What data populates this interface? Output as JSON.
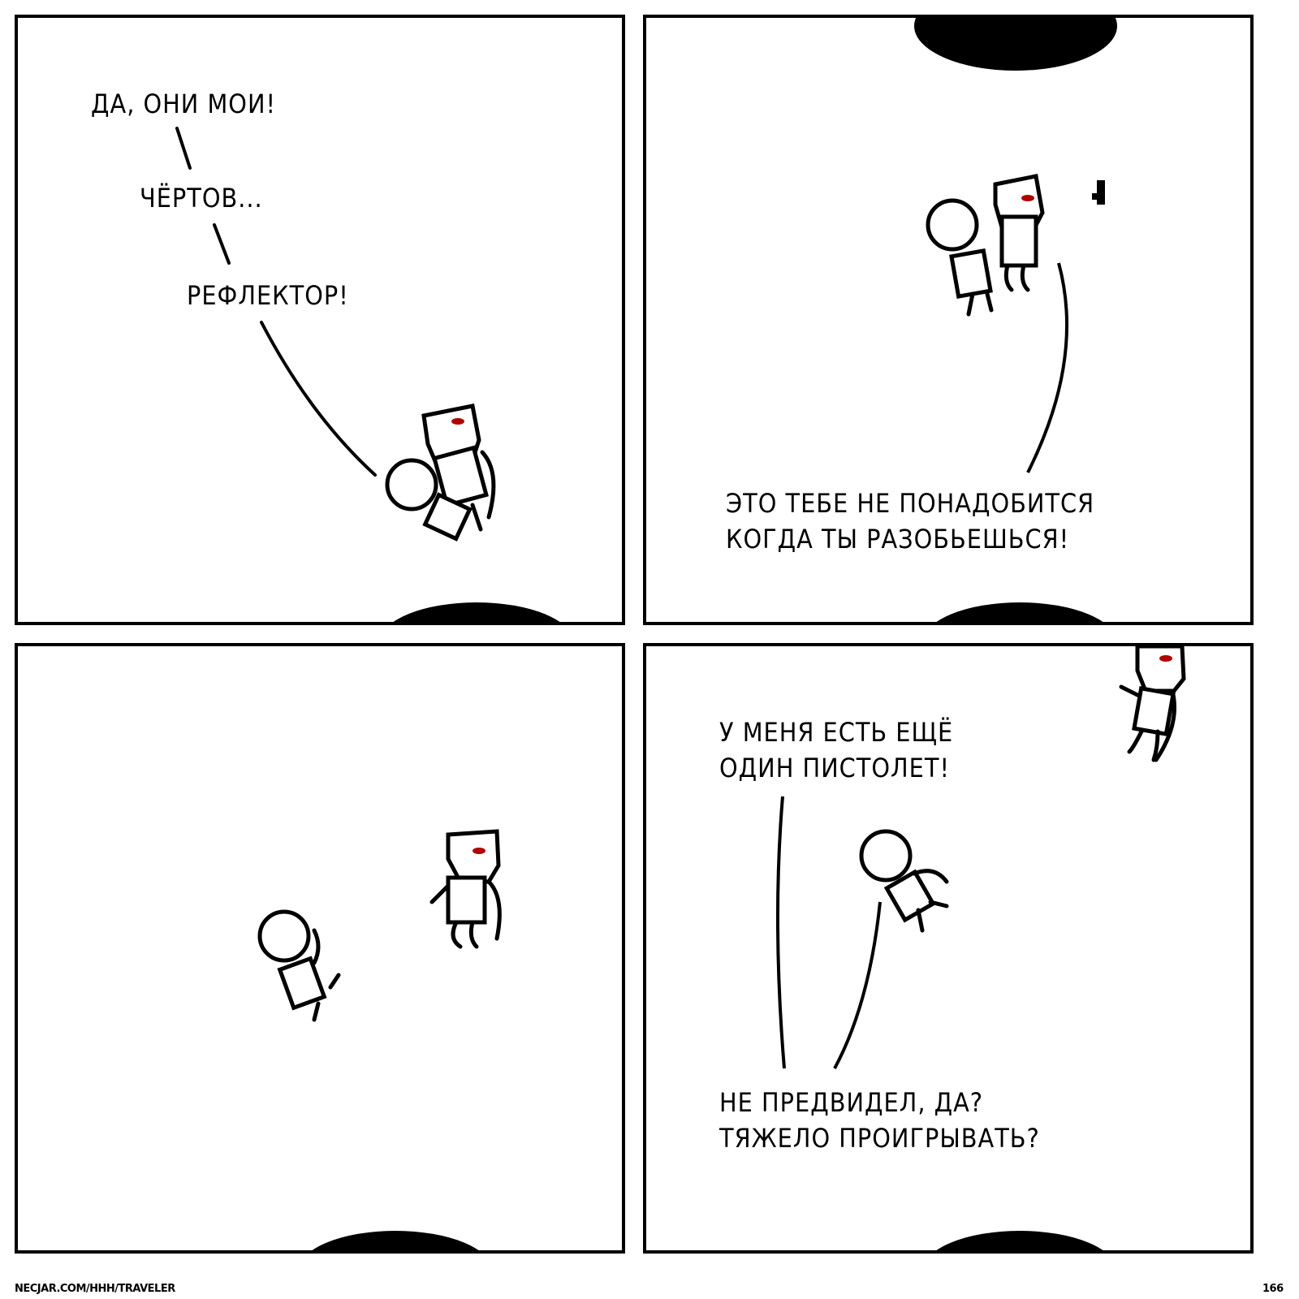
{
  "panels": [
    {
      "lines": [
        "Да, они мои!",
        "Чёртов...",
        "Рефлектор!"
      ]
    },
    {
      "lines": [
        "Это тебе не понадобится\nкогда ты разобьешься!"
      ]
    },
    {
      "lines": []
    },
    {
      "lines": [
        "У меня есть ещё\nодин пистолет!",
        "Не предвидел, да?\nТяжело проигрывать?"
      ]
    }
  ],
  "footer": {
    "site": "NECJAR.COM/HHH/TRAVELER",
    "page": "166"
  },
  "colors": {
    "ink": "#000000",
    "eyes": "#b00000",
    "background": "#ffffff"
  }
}
